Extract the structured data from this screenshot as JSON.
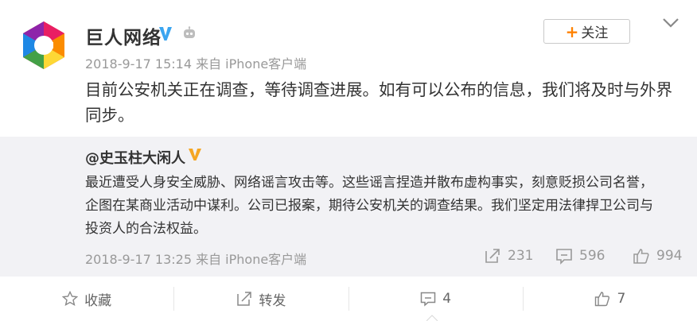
{
  "post": {
    "author": "巨人网络",
    "meta": "2018-9-17 15:14 来自 iPhone客户端",
    "text": "目前公安机关正在调查，等待调查进展。如有可以公布的信息，我们将及时与外界同步。",
    "follow_label": "关注",
    "follow_plus": "+"
  },
  "repost": {
    "author": "@史玉柱大闲人",
    "text": "最近遭受人身安全威胁、网络谣言攻击等。这些谣言捏造并散布虚构事实，刻意贬损公司名誉，企图在某商业活动中谋利。公司已报案，期待公安机关的调查结果。我们坚定用法律捍卫公司与投资人的合法权益。",
    "meta": "2018-9-17 13:25 来自 iPhone客户端",
    "reposts": "231",
    "comments": "596",
    "likes": "994"
  },
  "actions": {
    "favorite": "收藏",
    "repost": "转发",
    "comment": "4",
    "like": "7"
  },
  "colors": {
    "accent": "#ff8200",
    "verified_blue": "#3ba5f0",
    "verified_gold": "#f5a623",
    "repost_bg": "#f2f2f5"
  }
}
